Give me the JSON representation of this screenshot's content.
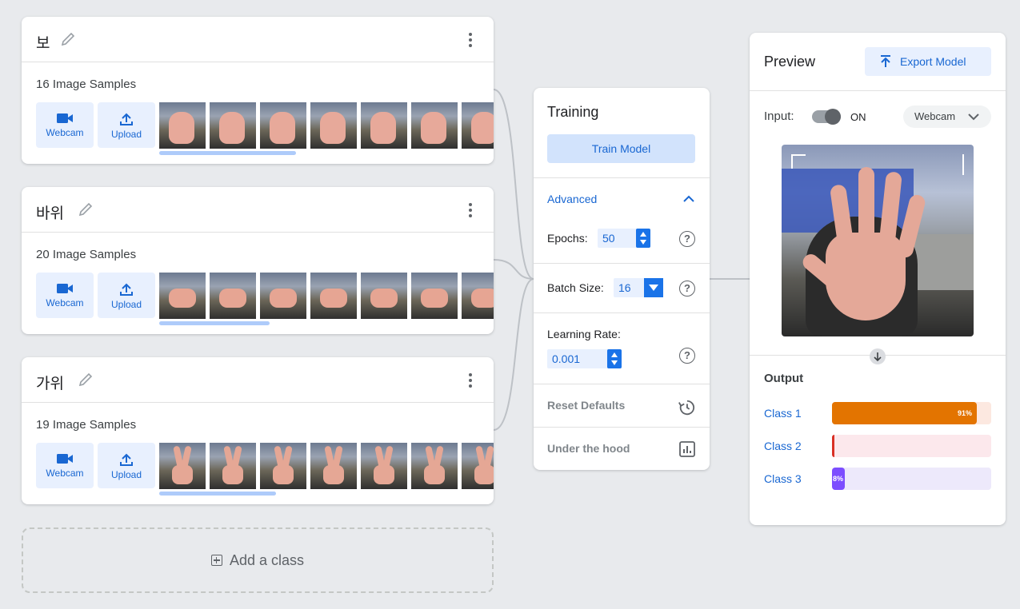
{
  "classes": [
    {
      "name": "보",
      "samples": "16 Image Samples",
      "webcam": "Webcam",
      "upload": "Upload",
      "gesture": "open",
      "scroll_fraction": 0.41
    },
    {
      "name": "바위",
      "samples": "20 Image Samples",
      "webcam": "Webcam",
      "upload": "Upload",
      "gesture": "fist",
      "scroll_fraction": 0.33
    },
    {
      "name": "가위",
      "samples": "19 Image Samples",
      "webcam": "Webcam",
      "upload": "Upload",
      "gesture": "scissors",
      "scroll_fraction": 0.35
    }
  ],
  "add_class": "Add a class",
  "training": {
    "title": "Training",
    "train_button": "Train Model",
    "advanced": "Advanced",
    "epochs_label": "Epochs:",
    "epochs_value": "50",
    "batch_label": "Batch Size:",
    "batch_value": "16",
    "lr_label": "Learning Rate:",
    "lr_value": "0.001",
    "help": "?",
    "reset": "Reset Defaults",
    "under_hood": "Under the hood"
  },
  "preview": {
    "title": "Preview",
    "export": "Export Model",
    "input_label": "Input:",
    "toggle_state": "ON",
    "source": "Webcam",
    "output_title": "Output",
    "outputs": [
      {
        "label": "Class 1",
        "percent": 91,
        "text": "91%",
        "color": "#e37400",
        "track": "#fce8e0"
      },
      {
        "label": "Class 2",
        "percent": 1,
        "text": "",
        "color": "#d93025",
        "track": "#fce8ec"
      },
      {
        "label": "Class 3",
        "percent": 8,
        "text": "8%",
        "color": "#7c4dff",
        "track": "#ede9fb"
      }
    ]
  },
  "colors": {
    "accent": "#1967d2",
    "accent_light": "#e8f0fe",
    "background": "#e8eaed"
  }
}
